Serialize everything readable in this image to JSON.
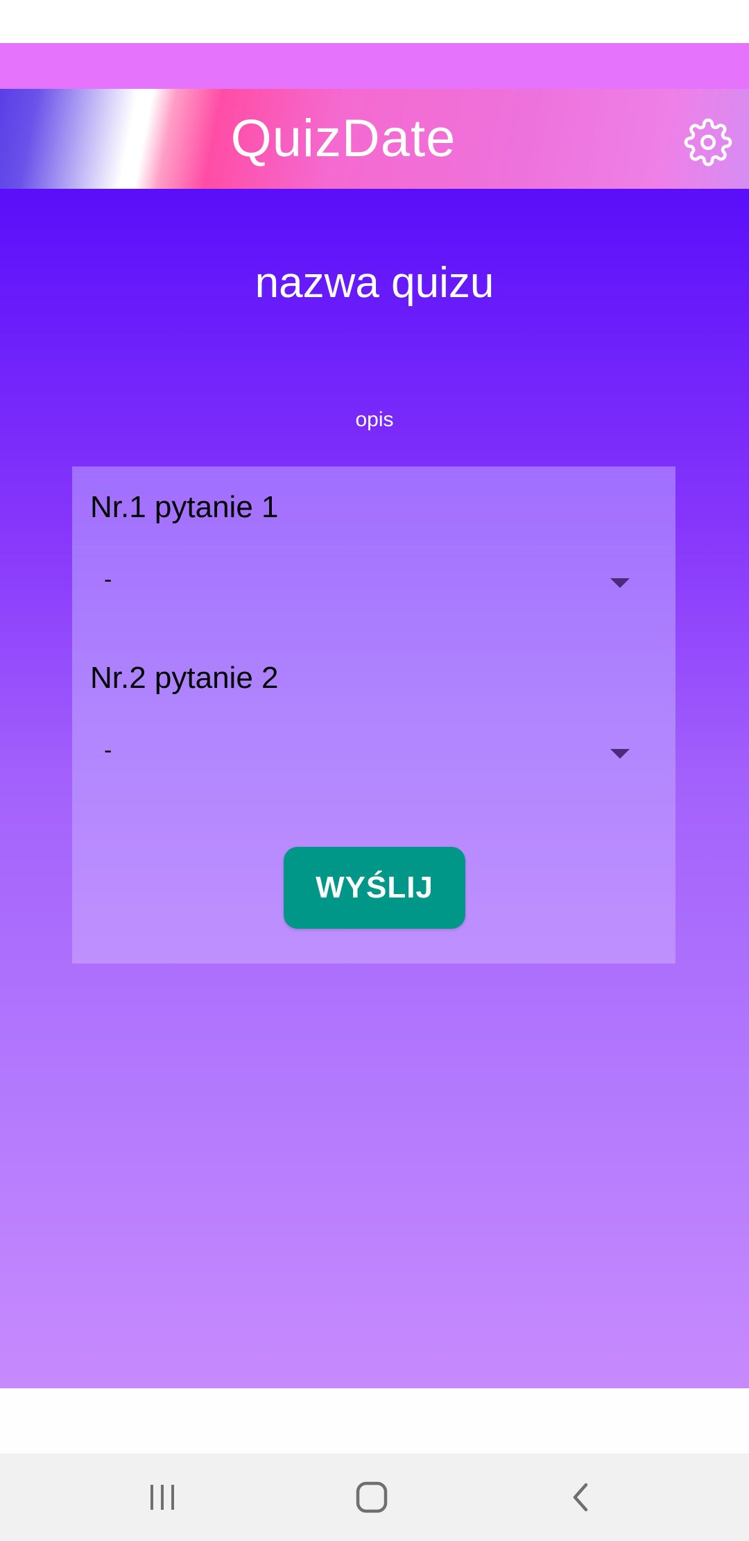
{
  "app_bar": {
    "title": "QuizDate",
    "settings_icon": "gear-icon"
  },
  "quiz": {
    "name": "nazwa quizu",
    "description": "opis"
  },
  "questions": [
    {
      "label": "Nr.1 pytanie 1",
      "selected": "-"
    },
    {
      "label": "Nr.2 pytanie 2",
      "selected": "-"
    }
  ],
  "submit": {
    "label": "WYŚLIJ"
  },
  "nav": {
    "recents_icon": "recents-icon",
    "home_icon": "home-icon",
    "back_icon": "back-icon"
  },
  "colors": {
    "accent_strip": "#e573fb",
    "content_top": "#5a0ef9",
    "content_bottom": "#c78afd",
    "submit_button": "#009688",
    "nav_bar": "#f1f1f1"
  }
}
